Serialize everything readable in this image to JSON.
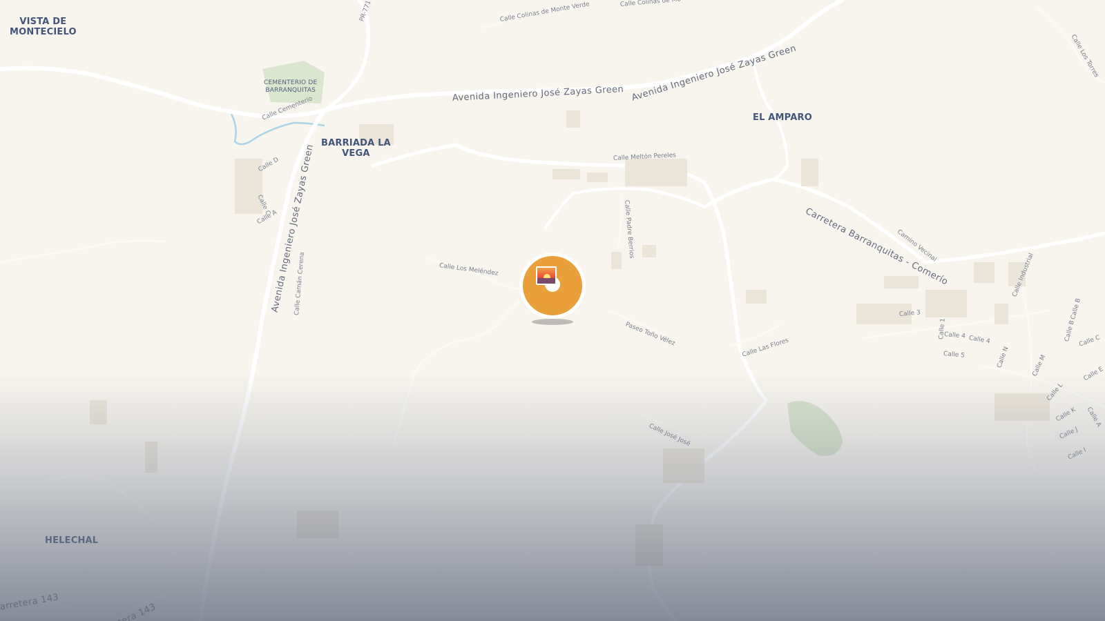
{
  "map": {
    "places": {
      "vista_de_montecielo": [
        "VISTA DE",
        "MONTECIELO"
      ],
      "cementerio": [
        "CEMENTERIO DE",
        "BARRANQUITAS"
      ],
      "barriada_la_vega": [
        "BARRIADA LA",
        "VEGA"
      ],
      "el_amparo": "EL AMPARO",
      "helechal": "HELECHAL"
    },
    "roads": {
      "pr_771": "PR-771",
      "colinas_monte_verde": "Calle Colinas de Monte Verde",
      "colinas_de_mo": "Calle Colinas de Mo",
      "zayas_green_1": "Avenida Ingeniero José Zayas Green",
      "zayas_green_2": "Avenida Ingeniero José Zayas Green",
      "zayas_green_vertical": "Avenida Ingeniero José Zayas Green",
      "calle_cementerio": "Calle Cementerio",
      "calle_d": "Calle D",
      "calle_c": "Calle C",
      "calle_a": "Calle A",
      "caman_cerena": "Calle Camán Cerena",
      "melton_pereles": "Calle Meltón Pereles",
      "padre_berrios": "Calle Padre Berrios",
      "los_melendez": "Calle Los Meléndez",
      "tono_velez": "Paseo Toño Vélez",
      "las_flores": "Calle Las Flores",
      "barranquitas_comerio": "Carretera Barranquitas - Comerío",
      "camino_vecinal": "Camino Vecinal",
      "calle_industrial": "Calle Industrial",
      "calle_3": "Calle 3",
      "calle_1": "Calle 1",
      "calle_4": "Calle 4",
      "calle_4b": "Calle 4",
      "calle_5": "Calle 5",
      "calle_n": "Calle N",
      "calle_m": "Calle M",
      "calle_b": "Calle B",
      "calle_b2": "Calle B",
      "calle_c_east": "Calle C",
      "calle_e": "Calle E",
      "calle_l": "Calle L",
      "calle_k": "Calle K",
      "calle_j": "Calle J",
      "calle_i": "Calle I",
      "calle_a_east": "Calle A",
      "jose_jose": "Calle José José",
      "los_torres": "Calle Los Torres",
      "carretera_143_a": "arretera 143",
      "carretera_143_b": "tera 143"
    },
    "marker": {
      "icon": "photo-sunset-icon",
      "color": "#e9a03a"
    }
  }
}
